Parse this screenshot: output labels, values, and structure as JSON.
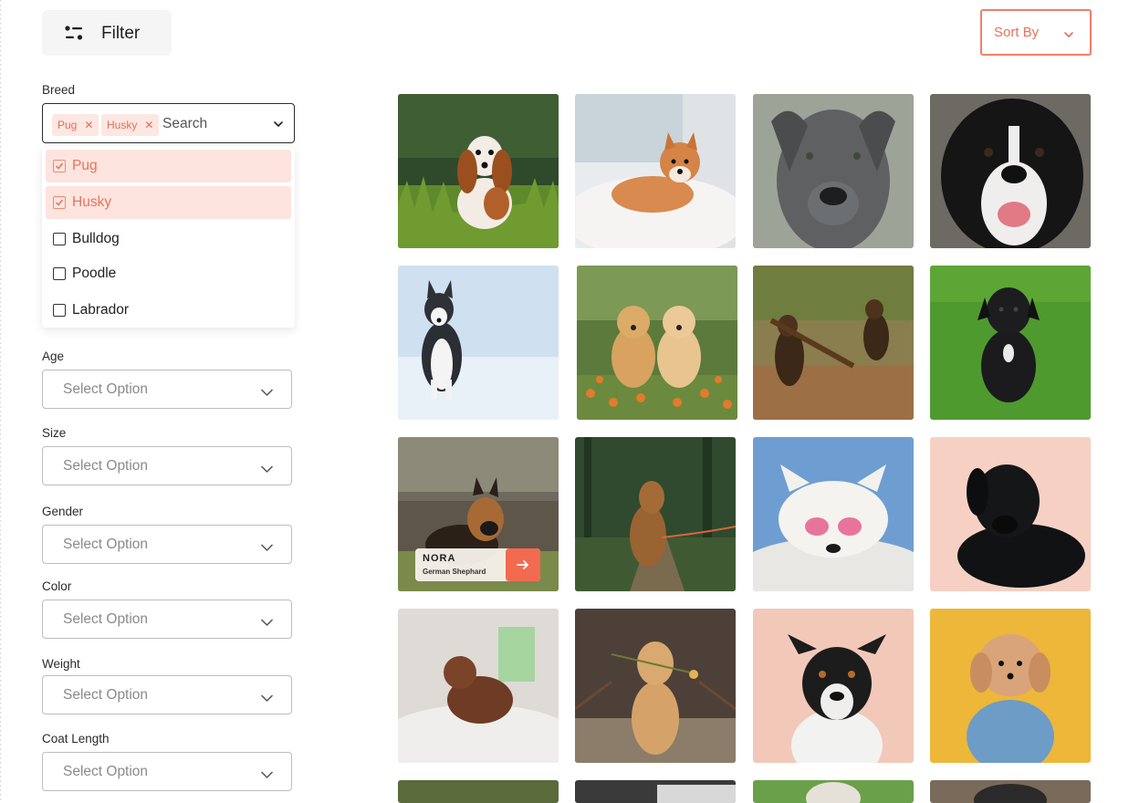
{
  "toolbar": {
    "filter_label": "Filter",
    "filter_icon": "sliders-icon",
    "sort_label": "Sort By",
    "sort_icon": "chevron-down-icon"
  },
  "colors": {
    "accent": "#ef7f68",
    "chip_bg": "#fde7e2",
    "selected_bg": "#fde4de"
  },
  "breed": {
    "label": "Breed",
    "chips": [
      "Pug",
      "Husky"
    ],
    "search_placeholder": "Search",
    "options": [
      {
        "label": "Pug",
        "checked": true
      },
      {
        "label": "Husky",
        "checked": true
      },
      {
        "label": "Bulldog",
        "checked": false
      },
      {
        "label": "Poodle",
        "checked": false
      },
      {
        "label": "Labrador",
        "checked": false
      }
    ]
  },
  "filters": [
    {
      "label": "Age",
      "value": "Select Option"
    },
    {
      "label": "Size",
      "value": "Select Option"
    },
    {
      "label": "Gender",
      "value": "Select Option"
    },
    {
      "label": "Color",
      "value": "Select Option"
    },
    {
      "label": "Weight",
      "value": "Select Option"
    },
    {
      "label": "Coat Length",
      "value": "Select Option"
    }
  ],
  "featured": {
    "name": "NORA",
    "breed": "German Shephard",
    "action_icon": "arrow-right-icon"
  }
}
